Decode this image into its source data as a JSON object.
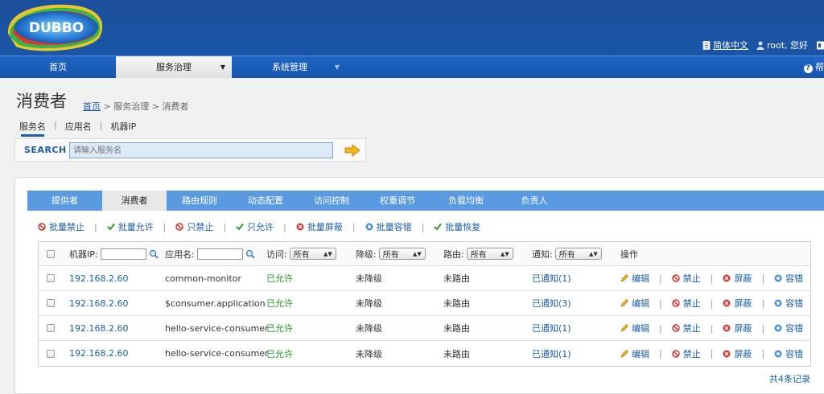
{
  "logo": {
    "text": "DUBBO"
  },
  "header": {
    "language": "简体中文",
    "user": "root, 您好"
  },
  "nav": {
    "items": [
      {
        "label": "首页"
      },
      {
        "label": "服务治理"
      },
      {
        "label": "系统管理"
      }
    ],
    "help": "帮"
  },
  "page": {
    "title": "消费者",
    "breadcrumb": {
      "home": "首页",
      "rest": " > 服务治理 > 消费者"
    }
  },
  "filter_tabs": [
    "服务名",
    "应用名",
    "机器IP"
  ],
  "search": {
    "label": "SEARCH",
    "placeholder": "请输入服务名"
  },
  "tabs": [
    "提供者",
    "消费者",
    "路由规则",
    "动态配置",
    "访问控制",
    "权重调节",
    "负载均衡",
    "负责人"
  ],
  "batch_actions": [
    "批量禁止",
    "批量允许",
    "只禁止",
    "只允许",
    "批量屏蔽",
    "批量容错",
    "批量恢复"
  ],
  "table": {
    "headers": {
      "ip": "机器IP:",
      "app": "应用名:",
      "access": "访问:",
      "degrade": "降级:",
      "route": "路由:",
      "notify": "通知:",
      "ops": "操作"
    },
    "select_value": "所有",
    "rows": [
      {
        "ip": "192.168.2.60",
        "app": "common-monitor",
        "access": "已允许",
        "degrade": "未降级",
        "route": "未路由",
        "notify": "已通知(1)"
      },
      {
        "ip": "192.168.2.60",
        "app": "$consumer.application",
        "access": "已允许",
        "degrade": "未降级",
        "route": "未路由",
        "notify": "已通知(3)"
      },
      {
        "ip": "192.168.2.60",
        "app": "hello-service-consumer",
        "access": "已允许",
        "degrade": "未降级",
        "route": "未路由",
        "notify": "已通知(1)"
      },
      {
        "ip": "192.168.2.60",
        "app": "hello-service-consumer",
        "access": "已允许",
        "degrade": "未降级",
        "route": "未路由",
        "notify": "已通知(1)"
      }
    ],
    "ops": [
      "编辑",
      "禁止",
      "屏蔽",
      "容错"
    ]
  },
  "footer": {
    "total": "共4条记录"
  },
  "colors": {
    "header": "#1c4f9c",
    "nav": "#1f66c6",
    "tabbar": "#5a9ae0",
    "link": "#1a5dab",
    "allowed": "#229922"
  }
}
